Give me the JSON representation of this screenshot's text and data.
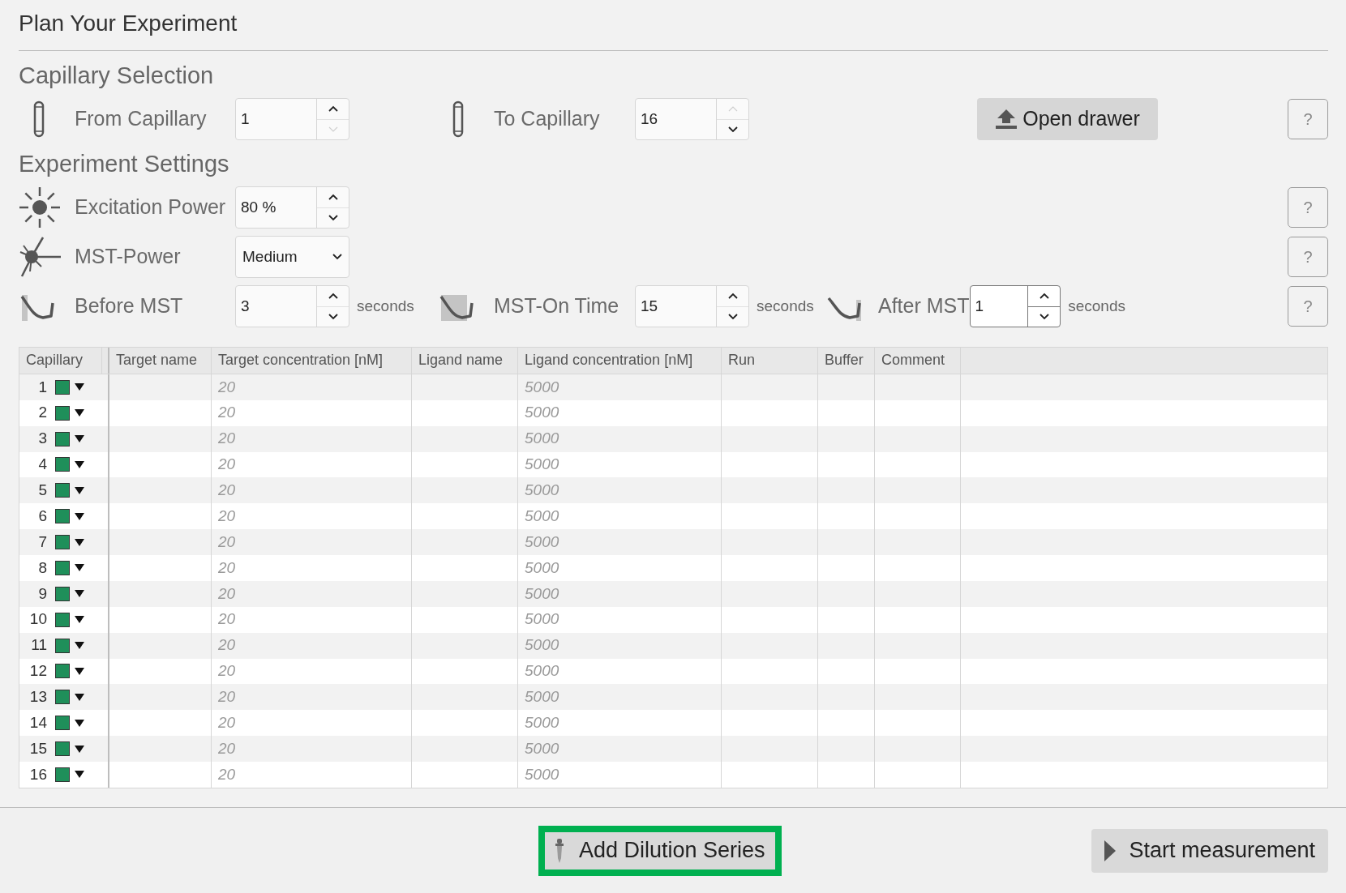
{
  "title": "Plan Your Experiment",
  "capillary_selection": {
    "heading": "Capillary Selection",
    "fields": [
      {
        "label": "From Capillary",
        "value": "1",
        "up_disabled": false,
        "down_disabled": true,
        "focused": false
      },
      {
        "label": "To Capillary",
        "value": "16",
        "up_disabled": true,
        "down_disabled": false,
        "focused": false
      }
    ],
    "open_drawer_button": "Open drawer",
    "help": "?"
  },
  "experiment_settings": {
    "heading": "Experiment Settings",
    "rows": [
      {
        "kind": "spinner",
        "help": "?",
        "fields": [
          {
            "label": "Excitation Power",
            "value": "80 %",
            "up_disabled": false,
            "down_disabled": false,
            "focused": false
          }
        ]
      },
      {
        "kind": "dropdown",
        "help": "?",
        "fields": [
          {
            "label": "MST-Power",
            "value": "Medium"
          }
        ]
      },
      {
        "kind": "spinner",
        "help": "?",
        "fields": [
          {
            "label": "Before MST",
            "value": "3",
            "unit": "seconds",
            "up_disabled": false,
            "down_disabled": false,
            "focused": false
          },
          {
            "label": "MST-On Time",
            "value": "15",
            "unit": "seconds",
            "up_disabled": false,
            "down_disabled": false,
            "focused": false
          },
          {
            "label": "After MST",
            "value": "1",
            "unit": "seconds",
            "up_disabled": false,
            "down_disabled": false,
            "focused": true
          }
        ]
      }
    ]
  },
  "table": {
    "columns": [
      "Capillary",
      "Target name",
      "Target concentration [nM]",
      "Ligand name",
      "Ligand concentration [nM]",
      "Run",
      "Buffer",
      "Comment"
    ],
    "rows": [
      {
        "capillary": "1",
        "color": "#1f8f5a",
        "target_concentration": "20",
        "ligand_concentration": "5000"
      },
      {
        "capillary": "2",
        "color": "#1f8f5a",
        "target_concentration": "20",
        "ligand_concentration": "5000"
      },
      {
        "capillary": "3",
        "color": "#1f8f5a",
        "target_concentration": "20",
        "ligand_concentration": "5000"
      },
      {
        "capillary": "4",
        "color": "#1f8f5a",
        "target_concentration": "20",
        "ligand_concentration": "5000"
      },
      {
        "capillary": "5",
        "color": "#1f8f5a",
        "target_concentration": "20",
        "ligand_concentration": "5000"
      },
      {
        "capillary": "6",
        "color": "#1f8f5a",
        "target_concentration": "20",
        "ligand_concentration": "5000"
      },
      {
        "capillary": "7",
        "color": "#1f8f5a",
        "target_concentration": "20",
        "ligand_concentration": "5000"
      },
      {
        "capillary": "8",
        "color": "#1f8f5a",
        "target_concentration": "20",
        "ligand_concentration": "5000"
      },
      {
        "capillary": "9",
        "color": "#1f8f5a",
        "target_concentration": "20",
        "ligand_concentration": "5000"
      },
      {
        "capillary": "10",
        "color": "#1f8f5a",
        "target_concentration": "20",
        "ligand_concentration": "5000"
      },
      {
        "capillary": "11",
        "color": "#1f8f5a",
        "target_concentration": "20",
        "ligand_concentration": "5000"
      },
      {
        "capillary": "12",
        "color": "#1f8f5a",
        "target_concentration": "20",
        "ligand_concentration": "5000"
      },
      {
        "capillary": "13",
        "color": "#1f8f5a",
        "target_concentration": "20",
        "ligand_concentration": "5000"
      },
      {
        "capillary": "14",
        "color": "#1f8f5a",
        "target_concentration": "20",
        "ligand_concentration": "5000"
      },
      {
        "capillary": "15",
        "color": "#1f8f5a",
        "target_concentration": "20",
        "ligand_concentration": "5000"
      },
      {
        "capillary": "16",
        "color": "#1f8f5a",
        "target_concentration": "20",
        "ligand_concentration": "5000"
      }
    ]
  },
  "footer": {
    "add_dilution_button": {
      "label": "Add Dilution Series",
      "highlighted": true
    },
    "start_button": "Start measurement"
  }
}
